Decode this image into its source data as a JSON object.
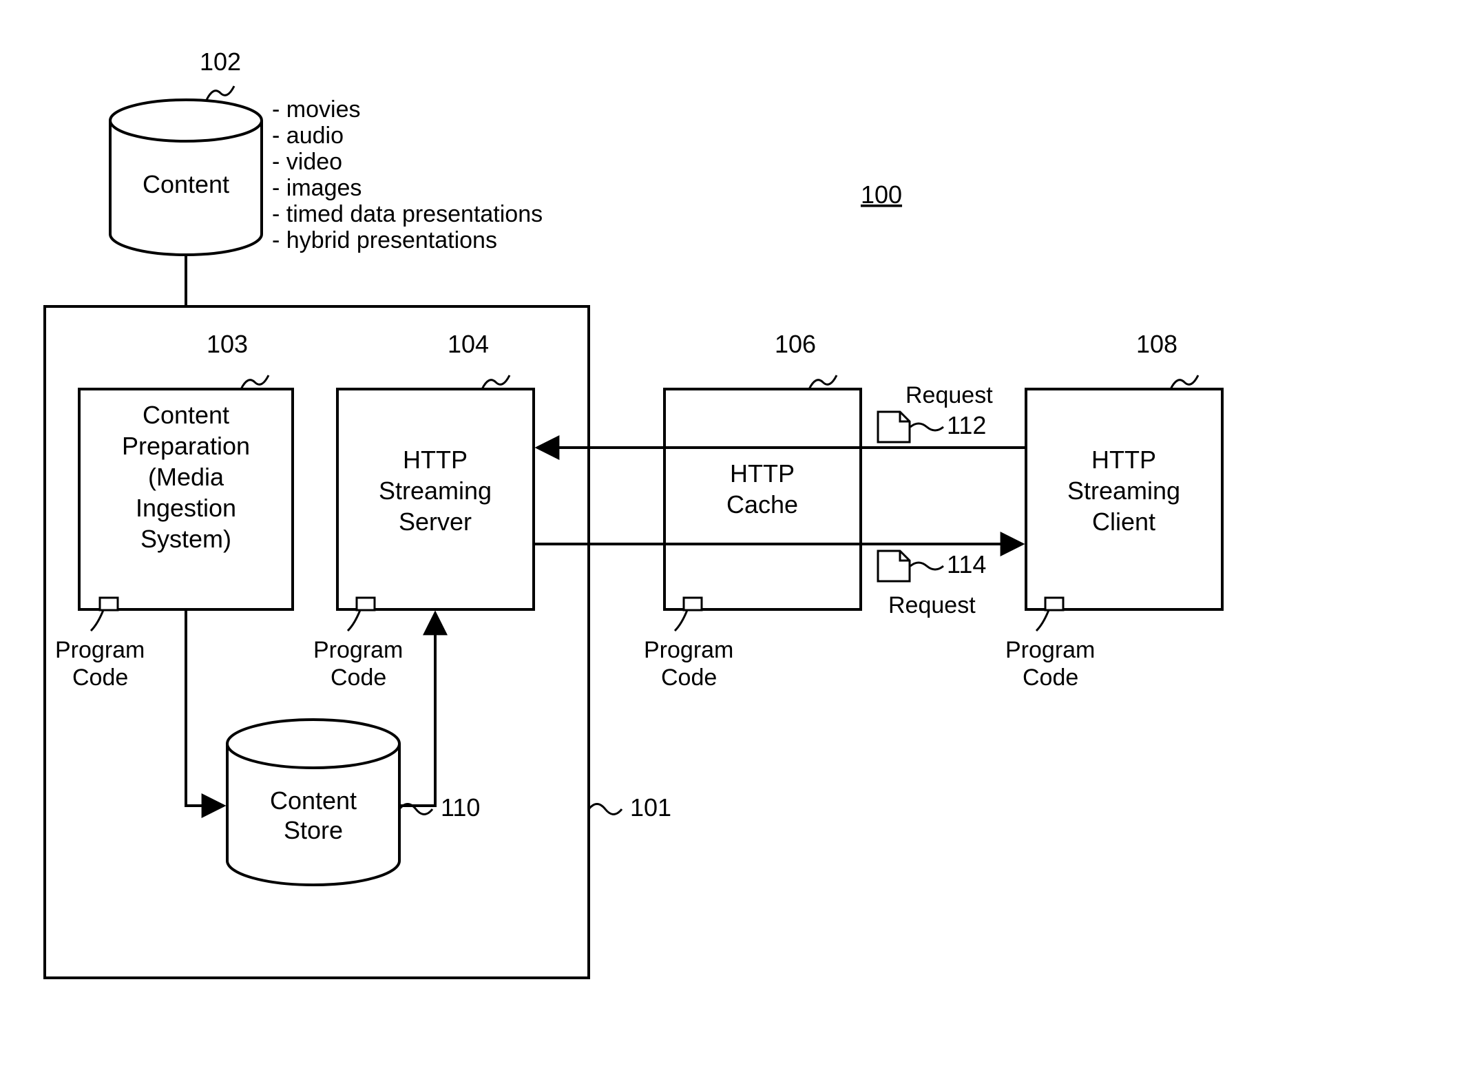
{
  "figureRef": "100",
  "content": {
    "label": "Content",
    "ref": "102",
    "types": [
      "movies",
      "audio",
      "video",
      "images",
      "timed data presentations",
      "hybrid presentations"
    ]
  },
  "serverGroup": {
    "ref": "101"
  },
  "contentPrep": {
    "ref": "103",
    "lines": [
      "Content",
      "Preparation",
      "(Media",
      "Ingestion",
      "System)"
    ],
    "program": [
      "Program",
      "Code"
    ]
  },
  "streamingServer": {
    "ref": "104",
    "lines": [
      "HTTP",
      "Streaming",
      "Server"
    ],
    "program": [
      "Program",
      "Code"
    ]
  },
  "contentStore": {
    "ref": "110",
    "lines": [
      "Content",
      "Store"
    ]
  },
  "httpCache": {
    "ref": "106",
    "lines": [
      "HTTP",
      "Cache"
    ],
    "program": [
      "Program",
      "Code"
    ]
  },
  "httpClient": {
    "ref": "108",
    "lines": [
      "HTTP",
      "Streaming",
      "Client"
    ],
    "program": [
      "Program",
      "Code"
    ]
  },
  "request1": {
    "label": "Request",
    "ref": "112"
  },
  "request2": {
    "label": "Request",
    "ref": "114"
  }
}
